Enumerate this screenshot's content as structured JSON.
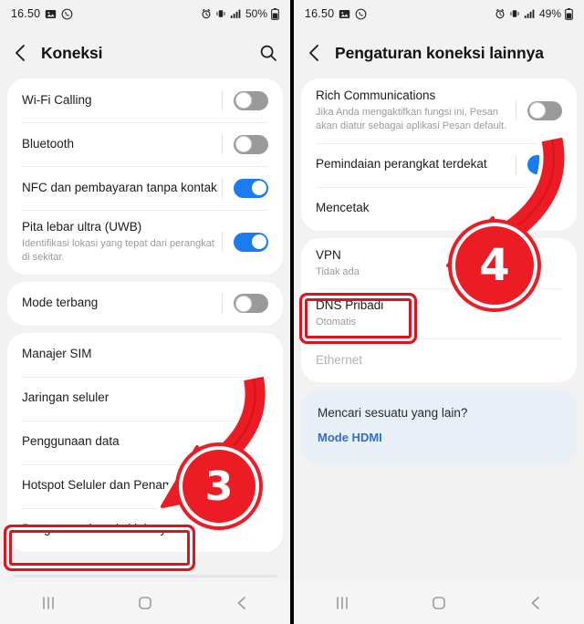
{
  "left_panel": {
    "statusbar": {
      "time": "16.50",
      "battery": "50%",
      "icons": [
        "gallery-icon",
        "whatsapp-icon",
        "alarm-icon",
        "vibrate-icon",
        "signal-icon",
        "battery-icon"
      ]
    },
    "header": {
      "title": "Koneksi",
      "back": "back-icon",
      "search": "search-icon"
    },
    "groups": [
      {
        "rows": [
          {
            "title": "Wi-Fi Calling",
            "sub": "",
            "toggle": "off"
          },
          {
            "title": "Bluetooth",
            "sub": "",
            "toggle": "off"
          },
          {
            "title": "NFC dan pembayaran tanpa kontak",
            "sub": "",
            "toggle": "on"
          },
          {
            "title": "Pita lebar ultra (UWB)",
            "sub": "Identifikasi lokasi yang tepat dari perangkat di sekitar.",
            "toggle": "on"
          }
        ]
      },
      {
        "rows": [
          {
            "title": "Mode terbang",
            "sub": "",
            "toggle": "off"
          }
        ]
      },
      {
        "rows": [
          {
            "title": "Manajer SIM",
            "sub": "",
            "toggle": ""
          },
          {
            "title": "Jaringan seluler",
            "sub": "",
            "toggle": ""
          },
          {
            "title": "Penggunaan data",
            "sub": "",
            "toggle": ""
          },
          {
            "title": "Hotspot Seluler dan Penambatan",
            "sub": "",
            "toggle": ""
          },
          {
            "title": "Pengaturan koneksi lainnya",
            "sub": "",
            "toggle": ""
          }
        ]
      }
    ],
    "annotation": {
      "step": "3",
      "target": "Pengaturan koneksi lainnya"
    }
  },
  "right_panel": {
    "statusbar": {
      "time": "16.50",
      "battery": "49%",
      "icons": [
        "gallery-icon",
        "whatsapp-icon",
        "alarm-icon",
        "vibrate-icon",
        "signal-icon",
        "battery-icon"
      ]
    },
    "header": {
      "title": "Pengaturan koneksi lainnya",
      "back": "back-icon"
    },
    "groups": [
      {
        "rows": [
          {
            "title": "Rich Communications",
            "sub": "Jika Anda mengaktifkan fungsi ini, Pesan akan diatur sebagai aplikasi Pesan default.",
            "toggle": "off"
          },
          {
            "title": "Pemindaian perangkat terdekat",
            "sub": "",
            "toggle": "on"
          },
          {
            "title": "Mencetak",
            "sub": "",
            "toggle": ""
          }
        ]
      },
      {
        "rows": [
          {
            "title": "VPN",
            "sub": "Tidak ada",
            "toggle": ""
          },
          {
            "title": "DNS Pribadi",
            "sub": "Otomatis",
            "toggle": ""
          },
          {
            "title": "Ethernet",
            "sub": "",
            "toggle": "",
            "disabled": true
          }
        ]
      }
    ],
    "promo": {
      "question": "Mencari sesuatu yang lain?",
      "link": "Mode HDMI"
    },
    "annotation": {
      "step": "4",
      "target": "DNS Pribadi"
    }
  },
  "navbar": {
    "recents": "recents-icon",
    "home": "home-icon",
    "back": "back-nav-icon"
  },
  "colors": {
    "accent_red": "#ed1c24",
    "toggle_on": "#1a7cf0",
    "link_blue": "#2f6dd0",
    "promo_bg": "#e8eff7"
  }
}
